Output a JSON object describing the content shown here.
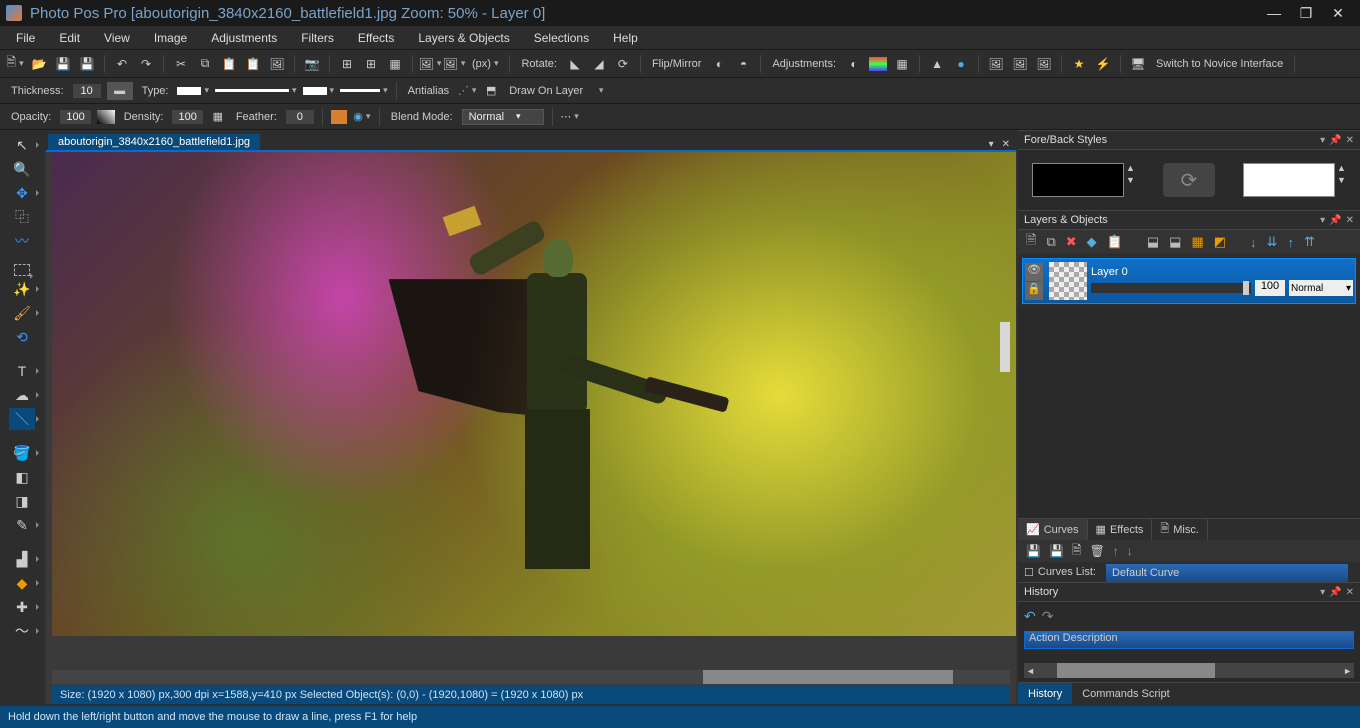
{
  "title": "Photo Pos Pro [aboutorigin_3840x2160_battlefield1.jpg Zoom: 50% - Layer 0]",
  "menu": [
    "File",
    "Edit",
    "View",
    "Image",
    "Adjustments",
    "Filters",
    "Effects",
    "Layers & Objects",
    "Selections",
    "Help"
  ],
  "tb1": {
    "rotate": "Rotate:",
    "flip": "Flip/Mirror",
    "adj": "Adjustments:",
    "switch": "Switch to Novice Interface",
    "px": "(px)"
  },
  "opt": {
    "thickness_l": "Thickness:",
    "thickness_v": "10",
    "type_l": "Type:",
    "antialias_l": "Antialias",
    "drawon_l": "Draw On Layer"
  },
  "opt2": {
    "opacity_l": "Opacity:",
    "opacity_v": "100",
    "density_l": "Density:",
    "density_v": "100",
    "feather_l": "Feather:",
    "feather_v": "0",
    "blend_l": "Blend Mode:",
    "blend_v": "Normal"
  },
  "tabname": "aboutorigin_3840x2160_battlefield1.jpg",
  "cstatus": "Size: (1920 x 1080) px,300 dpi   x=1588,y=410 px   Selected Object(s): (0,0) - (1920,1080) = (1920 x 1080) px",
  "panels": {
    "fb": "Fore/Back Styles",
    "lo": "Layers & Objects",
    "layer0": "Layer 0",
    "layer_op": "100",
    "layer_mode": "Normal",
    "curves": "Curves",
    "effects": "Effects",
    "misc": "Misc.",
    "clist": "Default Curve",
    "clist_pref": "Curves List:",
    "hist": "History",
    "hist_hdr": "Action Description",
    "bt_hist": "History",
    "bt_cs": "Commands Script"
  },
  "status": "Hold down the left/right button and move the mouse to draw a line, press F1 for help"
}
